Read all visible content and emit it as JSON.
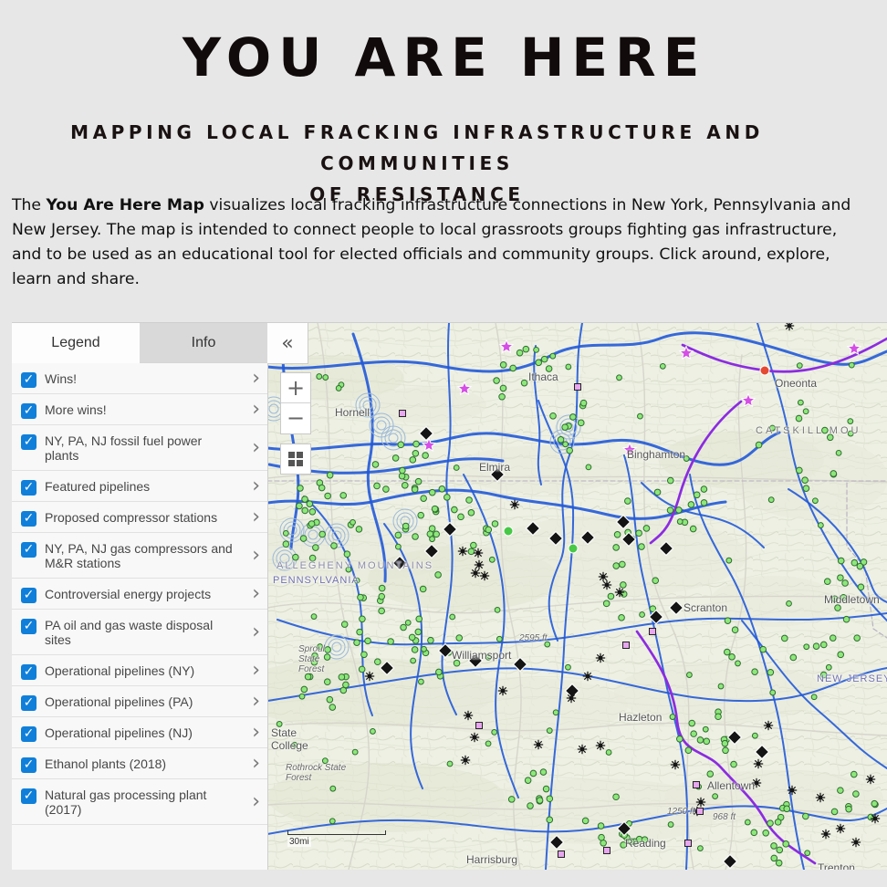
{
  "header": {
    "title": "YOU ARE HERE",
    "subtitle_line1": "MAPPING LOCAL FRACKING INFRASTRUCTURE AND COMMUNITIES",
    "subtitle_line2": "OF RESISTANCE"
  },
  "intro": {
    "prefix": "The ",
    "bold": "You Are Here Map",
    "suffix": " visualizes local fracking infrastructure connections in New York, Pennsylvania and New Jersey. The map is intended to connect people to local grassroots groups fighting gas infrastructure, and to be used as an educational tool for elected officials and community groups. Click around, explore, learn and share."
  },
  "panel": {
    "tabs": [
      {
        "label": "Legend",
        "active": true
      },
      {
        "label": "Info",
        "active": false
      }
    ],
    "items": [
      {
        "label": "Wins!"
      },
      {
        "label": "More wins!"
      },
      {
        "label": "NY, PA, NJ fossil fuel power plants"
      },
      {
        "label": "Featured pipelines"
      },
      {
        "label": "Proposed compressor stations"
      },
      {
        "label": "NY, PA, NJ gas compressors and M&R stations"
      },
      {
        "label": "Controversial energy projects"
      },
      {
        "label": "PA oil and gas waste disposal sites"
      },
      {
        "label": "Operational pipelines (NY)"
      },
      {
        "label": "Operational pipelines (PA)"
      },
      {
        "label": "Operational pipelines (NJ)"
      },
      {
        "label": "Ethanol plants (2018)"
      },
      {
        "label": "Natural gas processing plant (2017)"
      }
    ],
    "checkbox_icon": "checkmark-icon",
    "chevron_icon": "chevron-right-icon"
  },
  "map": {
    "controls": {
      "collapse": "«",
      "zoom_in": "+",
      "zoom_out": "−",
      "basemap_icon": "basemap-grid-icon"
    },
    "labels": [
      {
        "text": "Ithaca"
      },
      {
        "text": "Oneonta"
      },
      {
        "text": "Hornell"
      },
      {
        "text": "Elmira"
      },
      {
        "text": "Binghamton"
      },
      {
        "text": "CATSKILL MOU"
      },
      {
        "text": "ALLEGHENY MOUNTAINS"
      },
      {
        "text": "PENNSYLVANIA"
      },
      {
        "text": "Sproul State Forest"
      },
      {
        "text": "Williamsport"
      },
      {
        "text": "2595 ft"
      },
      {
        "text": "Scranton"
      },
      {
        "text": "Middletown"
      },
      {
        "text": "NEW JERSEY"
      },
      {
        "text": "Hazleton"
      },
      {
        "text": "State College"
      },
      {
        "text": "Rothrock State Forest"
      },
      {
        "text": "Allentown"
      },
      {
        "text": "Reading"
      },
      {
        "text": "Harrisburg"
      },
      {
        "text": "Trenton"
      },
      {
        "text": "1250 ft"
      },
      {
        "text": "968 ft"
      }
    ],
    "scale_bar": "30mi"
  },
  "colors": {
    "page_background": "#e7e7e7",
    "title": "#120b0b",
    "checkbox": "#0f7fd9",
    "pipeline_blue": "#2159d8",
    "featured_pipeline": "#8c2be0",
    "compressor_green": "#8ee77b",
    "win_star": "#d54ee5",
    "power_plant_black": "#141414",
    "waste_site_pink": "#e7a6ef",
    "road_grey": "#d7d5cc"
  }
}
